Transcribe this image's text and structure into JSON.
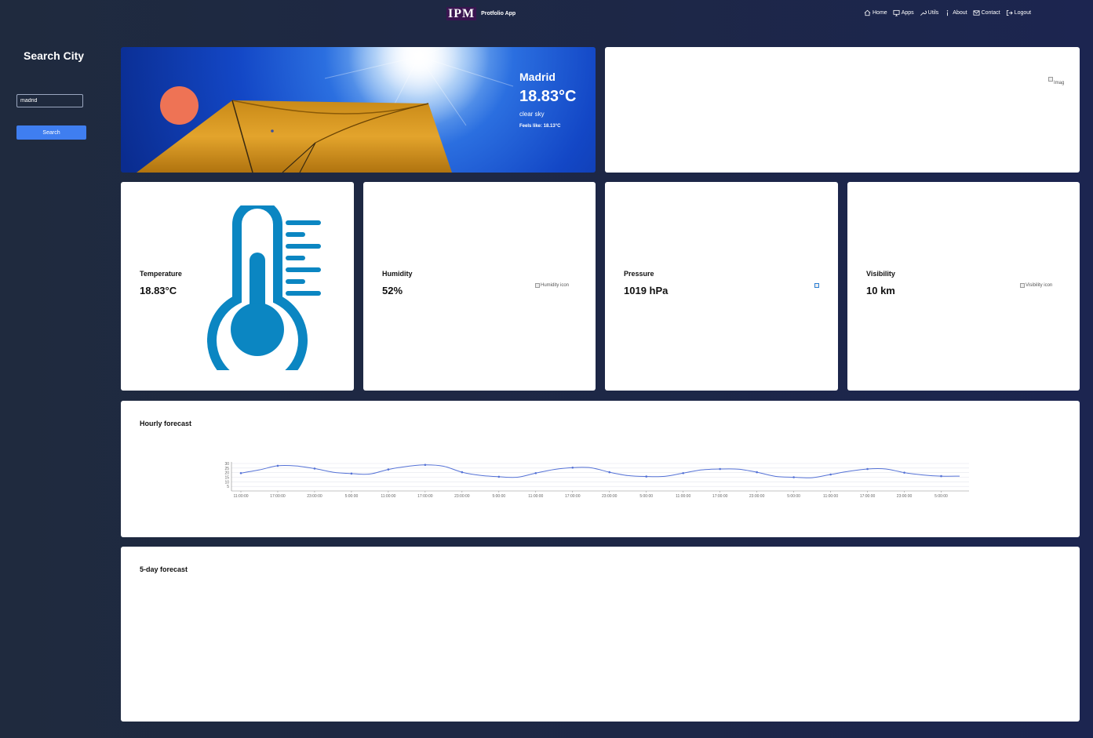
{
  "nav": {
    "brand_logo": "IPM",
    "brand_name": "Protfolio App",
    "links": [
      {
        "label": "Home",
        "icon": "home-icon"
      },
      {
        "label": "Apps",
        "icon": "monitor-icon"
      },
      {
        "label": "Utils",
        "icon": "wrench-icon"
      },
      {
        "label": "About",
        "icon": "info-icon"
      },
      {
        "label": "Contact",
        "icon": "mail-icon"
      },
      {
        "label": "Logout",
        "icon": "logout-icon"
      }
    ]
  },
  "sidebar": {
    "title": "Search City",
    "input_value": "madrid",
    "search_label": "Search"
  },
  "weather": {
    "city": "Madrid",
    "temperature": "18.83°C",
    "description": "clear sky",
    "feels_like": "Feels like: 18.13°C",
    "map_alt": "Imag"
  },
  "metrics": [
    {
      "label": "Temperature",
      "value": "18.83°C",
      "icon": "thermometer-icon"
    },
    {
      "label": "Humidity",
      "value": "52%",
      "icon_alt": "Humidity icon"
    },
    {
      "label": "Pressure",
      "value": "1019 hPa",
      "icon_alt": ""
    },
    {
      "label": "Visibility",
      "value": "10 km",
      "icon_alt": "Visibility icon"
    }
  ],
  "hourly": {
    "title": "Hourly forecast"
  },
  "five_day": {
    "title": "5-day forecast"
  },
  "colors": {
    "accent": "#3f7ef0",
    "orb": "#ee7355",
    "thermometer": "#0b86c2",
    "line": "#5572d6"
  },
  "chart_data": {
    "type": "line",
    "y_ticks": [
      "30",
      "25",
      "20",
      "15",
      "10",
      "5"
    ],
    "ylim": [
      0,
      30
    ],
    "x_tick_labels": [
      "11:00:00",
      "17:00:00",
      "23:00:00",
      "5:00:00",
      "11:00:00",
      "17:00:00",
      "23:00:00",
      "5:00:00",
      "11:00:00",
      "17:00:00",
      "23:00:00",
      "5:00:00",
      "11:00:00",
      "17:00:00",
      "23:00:00",
      "5:00:00",
      "11:00:00",
      "17:00:00",
      "23:00:00",
      "5:00:00"
    ],
    "values": [
      19.5,
      23,
      27.5,
      27.3,
      24.5,
      20.5,
      19,
      18.5,
      23.5,
      26.8,
      28.5,
      27,
      20.5,
      17,
      15.5,
      15,
      19.5,
      23.5,
      25.5,
      25.3,
      20.5,
      16.8,
      15.8,
      16,
      19.5,
      23,
      24,
      23.8,
      20.5,
      16,
      15,
      14.5,
      18,
      21.5,
      24,
      24,
      20,
      17.5,
      16.2,
      16.2
    ],
    "grid": true
  }
}
